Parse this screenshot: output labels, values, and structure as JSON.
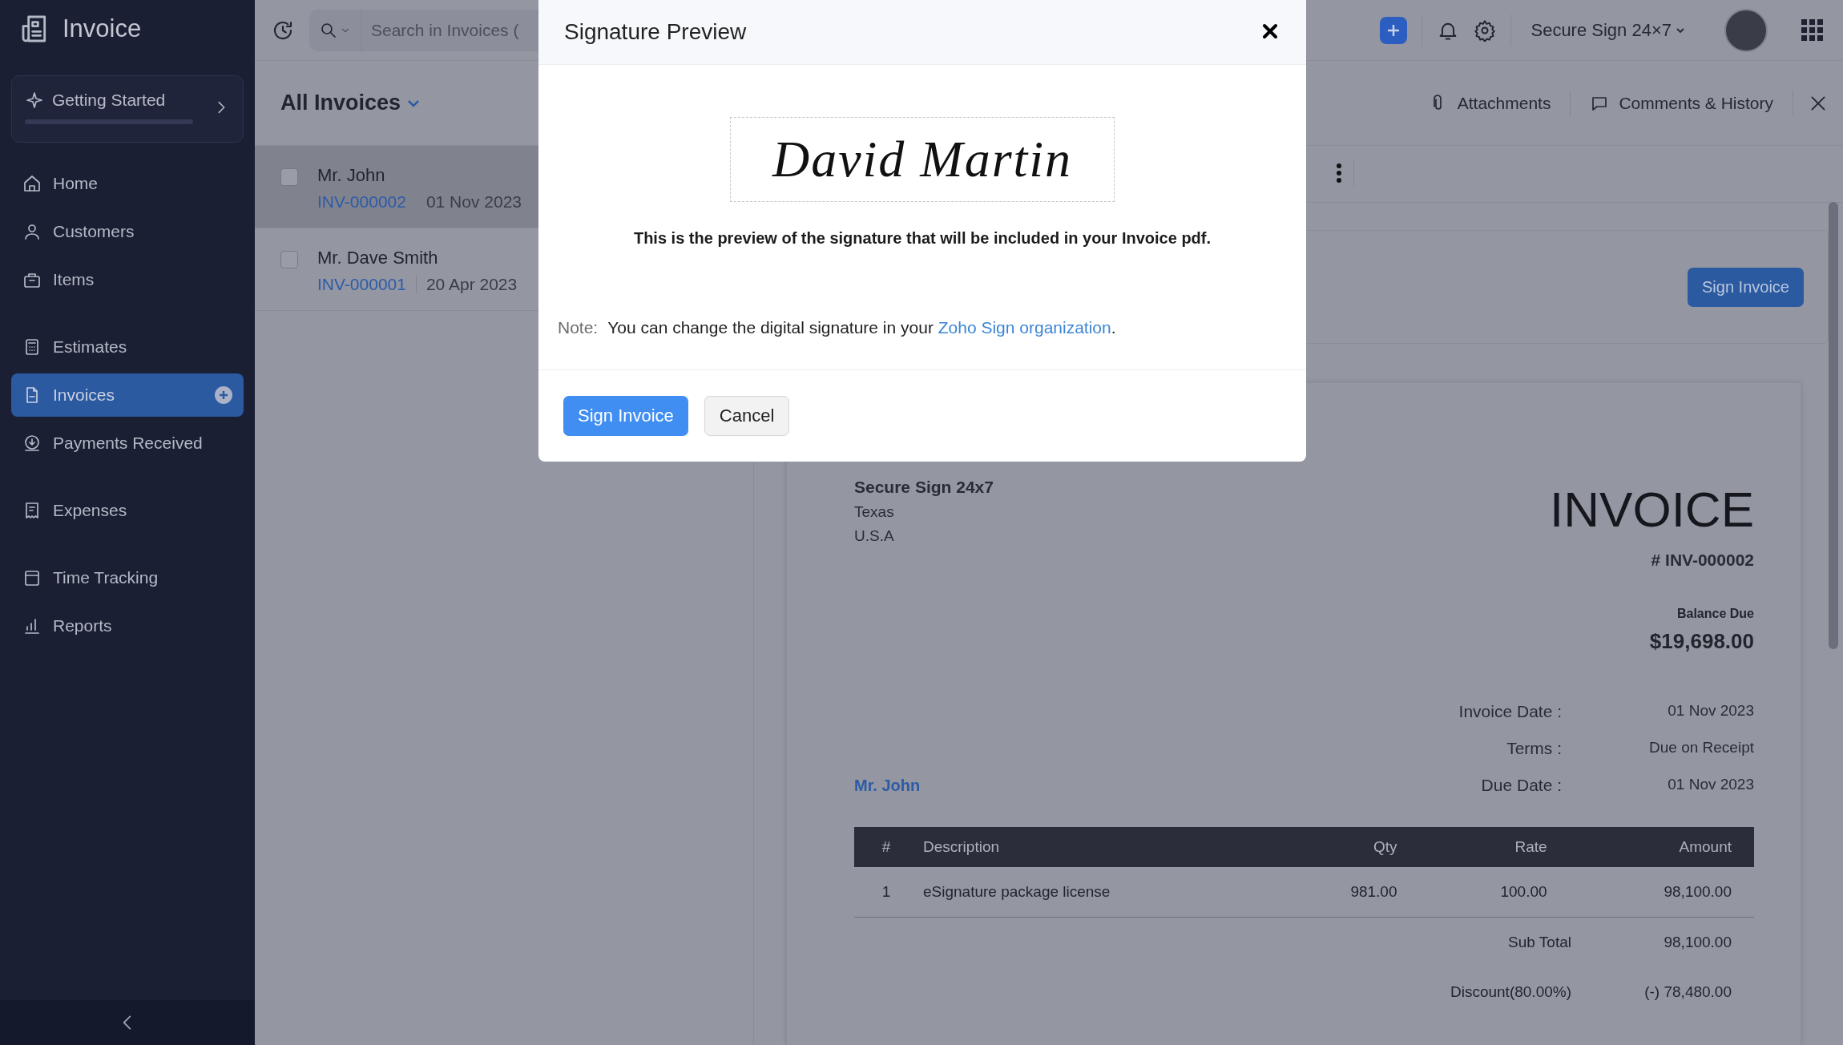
{
  "sidebar": {
    "app_title": "Invoice",
    "getting_started": {
      "label": "Getting Started",
      "level": 0
    },
    "items": [
      {
        "label": "Home",
        "selected": false,
        "add_button": false
      },
      {
        "label": "Customers",
        "selected": false,
        "add_button": false
      },
      {
        "label": "Items",
        "selected": false,
        "add_button": false
      },
      {
        "label": "Estimates",
        "selected": false,
        "add_button": false
      },
      {
        "label": "Invoices",
        "selected": true,
        "add_button": true
      },
      {
        "label": "Payments Received",
        "selected": false,
        "add_button": false
      },
      {
        "label": "Expenses",
        "selected": false,
        "add_button": false
      },
      {
        "label": "Time Tracking",
        "selected": false,
        "add_button": false
      },
      {
        "label": "Reports",
        "selected": false,
        "add_button": false
      }
    ]
  },
  "topbar": {
    "search": {
      "placeholder": "Search in Invoices ("
    },
    "organization": "Secure Sign 24×7"
  },
  "invoice_list": {
    "title": "All Invoices",
    "rows": [
      {
        "customer": "Mr. John",
        "number": "INV-000002",
        "date": "01 Nov 2023",
        "selected": true,
        "checked": false
      },
      {
        "customer": "Mr. Dave Smith",
        "number": "INV-000001",
        "date": "20 Apr 2023",
        "selected": false,
        "checked": false
      }
    ]
  },
  "detail": {
    "header_links": [
      "Attachments",
      "Comments & History"
    ],
    "sign_button": "Sign Invoice",
    "document": {
      "company": "Secure Sign 24x7",
      "address": [
        "Texas",
        "U.S.A"
      ],
      "heading": "INVOICE",
      "number": "# INV-000002",
      "balance_label": "Balance Due",
      "balance": "$19,698.00",
      "fields": [
        {
          "label": "Invoice Date :",
          "value": "01 Nov 2023"
        },
        {
          "label": "Terms :",
          "value": "Due on Receipt"
        },
        {
          "label": "Due Date :",
          "value": "01 Nov 2023"
        }
      ],
      "bill_to": "Mr. John",
      "table": {
        "columns": [
          "#",
          "Description",
          "Qty",
          "Rate",
          "Amount"
        ],
        "rows": [
          [
            "1",
            "eSignature package license",
            "981.00",
            "100.00",
            "98,100.00"
          ]
        ]
      },
      "totals": [
        {
          "label": "Sub Total",
          "value": "98,100.00"
        },
        {
          "label": "Discount(80.00%)",
          "value": "(-) 78,480.00"
        }
      ]
    }
  },
  "modal": {
    "title": "Signature Preview",
    "signature": "David Martin",
    "message": "This is the preview of the signature that will be included in your Invoice pdf.",
    "note_label": "Note:",
    "note_text": "You can change the digital signature in your ",
    "note_link": "Zoho Sign organization",
    "note_end": ".",
    "primary_button": "Sign Invoice",
    "cancel_button": "Cancel"
  }
}
